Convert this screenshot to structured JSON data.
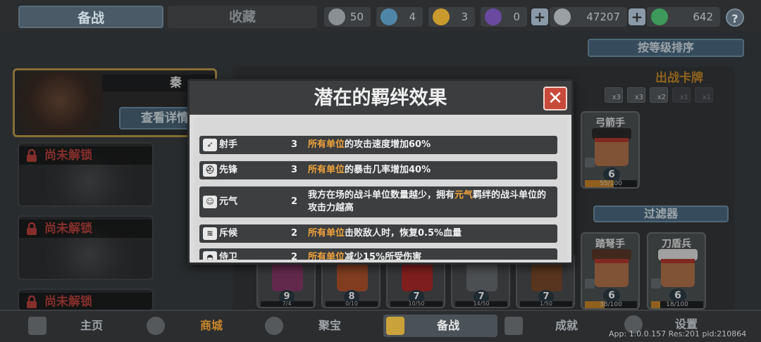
{
  "top": {
    "tabs": [
      {
        "label": "备战",
        "active": true
      },
      {
        "label": "收藏",
        "active": false
      }
    ],
    "resources": [
      {
        "icon": "silver-badge-icon",
        "value": "50"
      },
      {
        "icon": "blue-badge-icon",
        "value": "4"
      },
      {
        "icon": "gold-badge-icon",
        "value": "3"
      },
      {
        "icon": "purple-badge-icon",
        "value": "0"
      }
    ],
    "coins": {
      "icon": "coin-icon",
      "value": "47207"
    },
    "gems": {
      "icon": "gem-icon",
      "value": "642"
    },
    "help": "?"
  },
  "sort_button": "按等级排序",
  "heroes": {
    "main": {
      "name": "秦",
      "detail_button": "查看详情"
    },
    "locked_label": "尚未解锁"
  },
  "deck": {
    "title": "出战卡牌",
    "chips": [
      "x3",
      "x3",
      "x2",
      "x1",
      "x1"
    ],
    "filter_button": "过滤器",
    "units": [
      {
        "name": "弓箭手",
        "level": "6",
        "xp": "55/100",
        "xp_fraction": 0.55
      },
      {
        "name": "踏弩手",
        "level": "6",
        "xp": "38/100",
        "xp_fraction": 0.38
      },
      {
        "name": "刀盾兵",
        "level": "6",
        "xp": "18/100",
        "xp_fraction": 0.18
      }
    ],
    "bottom_units": [
      {
        "level": "9",
        "xp": "7/4",
        "color": "#8a3a6a"
      },
      {
        "level": "8",
        "xp": "0/10",
        "color": "#b5552e"
      },
      {
        "level": "7",
        "xp": "10/50",
        "color": "#b02a2a"
      },
      {
        "level": "7",
        "xp": "14/50",
        "color": "#6a6e72"
      },
      {
        "level": "7",
        "xp": "1/50",
        "color": "#7a4a2a"
      }
    ]
  },
  "modal": {
    "title": "潜在的羁绊效果",
    "close": "✕",
    "effects": [
      {
        "icon": "archer-icon",
        "glyph": "➶",
        "name": "射手",
        "count": "3",
        "highlight": "所有单位",
        "desc": "的攻击速度增加60%"
      },
      {
        "icon": "vanguard-icon",
        "glyph": "⛑",
        "name": "先锋",
        "count": "3",
        "highlight": "所有单位",
        "desc": "的暴击几率增加40%"
      },
      {
        "icon": "spirit-icon",
        "glyph": "☺",
        "name": "元气",
        "count": "2",
        "desc_pre": "我方在场的战斗单位数量越少，拥有",
        "highlight": "元气",
        "desc_post": "羁绊的战斗单位的攻击力越高"
      },
      {
        "icon": "scout-icon",
        "glyph": "≋",
        "name": "斥候",
        "count": "2",
        "highlight": "所有单位",
        "desc": "击败敌人时，恢复0.5%血量"
      },
      {
        "icon": "guard-icon",
        "glyph": "◓",
        "name": "侍卫",
        "count": "2",
        "highlight": "所有单位",
        "desc": "减少15%所受伤害"
      }
    ]
  },
  "nav": [
    {
      "label": "主页",
      "icon": "home-icon"
    },
    {
      "label": "商城",
      "icon": "shop-icon",
      "accent": true
    },
    {
      "label": "聚宝",
      "icon": "treasure-icon"
    },
    {
      "label": "备战",
      "icon": "prepare-icon",
      "active": true
    },
    {
      "label": "成就",
      "icon": "achievement-icon"
    },
    {
      "label": "设置",
      "icon": "settings-icon"
    }
  ],
  "version": "App: 1.0.0.157 Res:201 pid:210864",
  "colors": {
    "accent": "#f0a43a",
    "lock_red": "#b8423c",
    "close_red": "#c84a3a"
  }
}
